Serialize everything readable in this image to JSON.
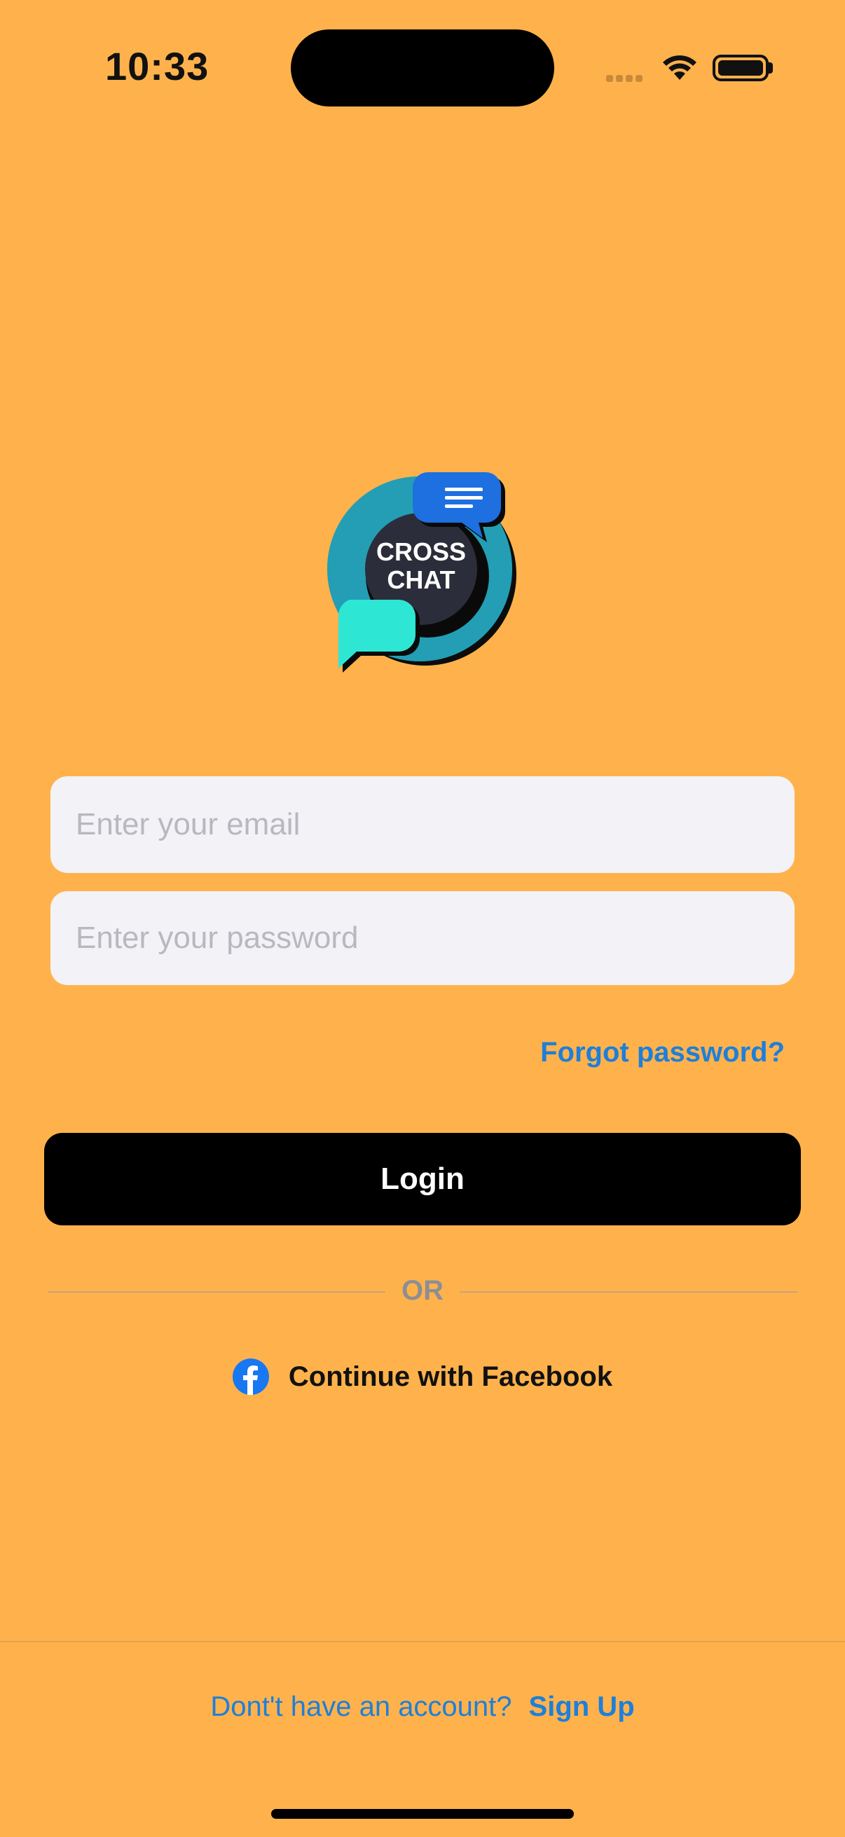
{
  "status_bar": {
    "time": "10:33"
  },
  "logo": {
    "line1": "CROSS",
    "line2": "CHAT"
  },
  "form": {
    "email_placeholder": "Enter your email",
    "password_placeholder": "Enter your password",
    "forgot_label": "Forgot password?",
    "login_label": "Login"
  },
  "divider": {
    "or_label": "OR"
  },
  "social": {
    "facebook_label": "Continue with Facebook"
  },
  "footer": {
    "question": "Dont't have an account?",
    "signup_label": "Sign Up"
  },
  "colors": {
    "background": "#FFB24C",
    "accent": "#1E7FD9",
    "button": "#000000",
    "field": "#F2F2F7"
  }
}
